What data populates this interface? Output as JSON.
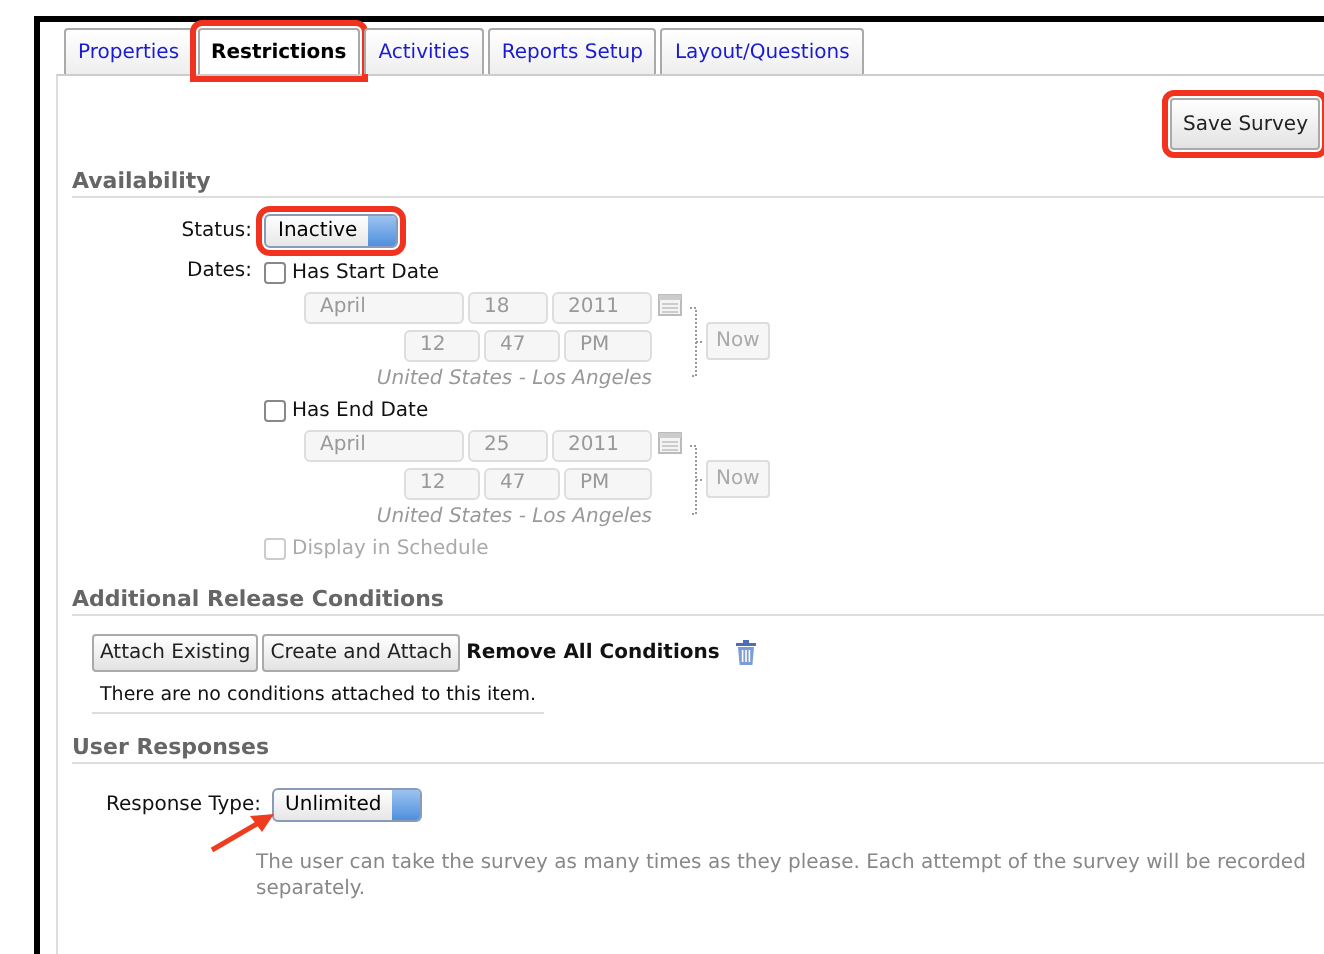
{
  "tabs": [
    {
      "label": "Properties",
      "selected": false,
      "highlighted": false
    },
    {
      "label": "Restrictions",
      "selected": true,
      "highlighted": true
    },
    {
      "label": "Activities",
      "selected": false,
      "highlighted": false
    },
    {
      "label": "Reports Setup",
      "selected": false,
      "highlighted": false
    },
    {
      "label": "Layout/Questions",
      "selected": false,
      "highlighted": false
    }
  ],
  "save_button": {
    "label": "Save Survey",
    "highlighted": true
  },
  "availability": {
    "heading": "Availability",
    "status_label": "Status:",
    "status": {
      "value": "Inactive",
      "highlighted": true
    },
    "dates_label": "Dates:",
    "date_blocks": [
      {
        "label": "Has Start Date",
        "checked": false,
        "disabled": true,
        "month": "April",
        "day": "18",
        "year": "2011",
        "hour": "12",
        "minute": "47",
        "ampm": "PM",
        "timezone": "United States - Los Angeles",
        "now": "Now"
      },
      {
        "label": "Has End Date",
        "checked": false,
        "disabled": true,
        "month": "April",
        "day": "25",
        "year": "2011",
        "hour": "12",
        "minute": "47",
        "ampm": "PM",
        "timezone": "United States - Los Angeles",
        "now": "Now"
      }
    ],
    "display_in_schedule": {
      "label": "Display in Schedule",
      "checked": false,
      "disabled": true
    }
  },
  "release_conditions": {
    "heading": "Additional Release Conditions",
    "buttons": [
      "Attach Existing",
      "Create and Attach"
    ],
    "remove_all": "Remove All Conditions",
    "empty_message": "There are no conditions attached to this item."
  },
  "user_responses": {
    "heading": "User Responses",
    "response_type_label": "Response Type:",
    "response_type": {
      "value": "Unlimited",
      "highlighted": false,
      "arrow": true
    },
    "description": "The user can take the survey as many times as they please. Each attempt of the survey will be recorded separately."
  }
}
